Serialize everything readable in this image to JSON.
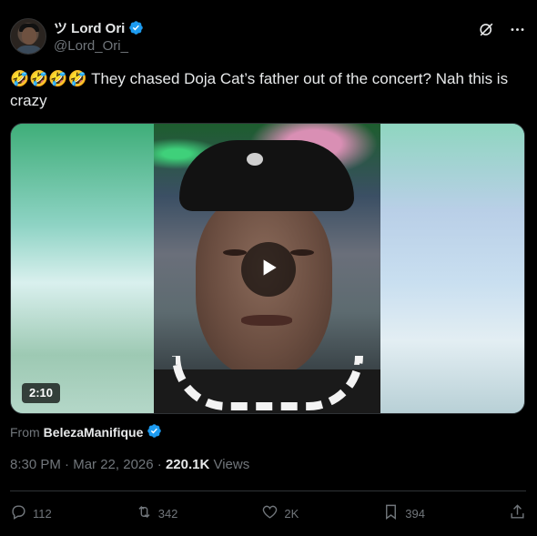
{
  "author": {
    "display_name": "ツ Lord Ori",
    "handle": "@Lord_Ori_",
    "verified": true
  },
  "tweet": {
    "text": "🤣🤣🤣🤣 They chased Doja Cat’s father out of the concert? Nah this is crazy"
  },
  "media": {
    "type": "video",
    "duration": "2:10"
  },
  "attribution": {
    "prefix": "From",
    "source_name": "BelezaManifique",
    "source_verified": true
  },
  "meta": {
    "time": "8:30 PM",
    "separator1": " · ",
    "date": "Mar 22, 2026",
    "separator2": " · ",
    "views_count": "220.1K",
    "views_label": " Views"
  },
  "actions": {
    "replies": "112",
    "reposts": "342",
    "likes": "2K",
    "bookmarks": "394"
  },
  "icons": {
    "verified": "verified-badge-icon",
    "grok": "grok-icon",
    "more": "more-icon",
    "reply": "reply-icon",
    "repost": "repost-icon",
    "like": "heart-icon",
    "bookmark": "bookmark-icon",
    "share": "share-icon",
    "play": "play-icon"
  },
  "colors": {
    "background": "#000000",
    "text": "#e7e9ea",
    "muted": "#71767b",
    "verified_blue": "#1d9bf0",
    "divider": "#2f3336"
  }
}
